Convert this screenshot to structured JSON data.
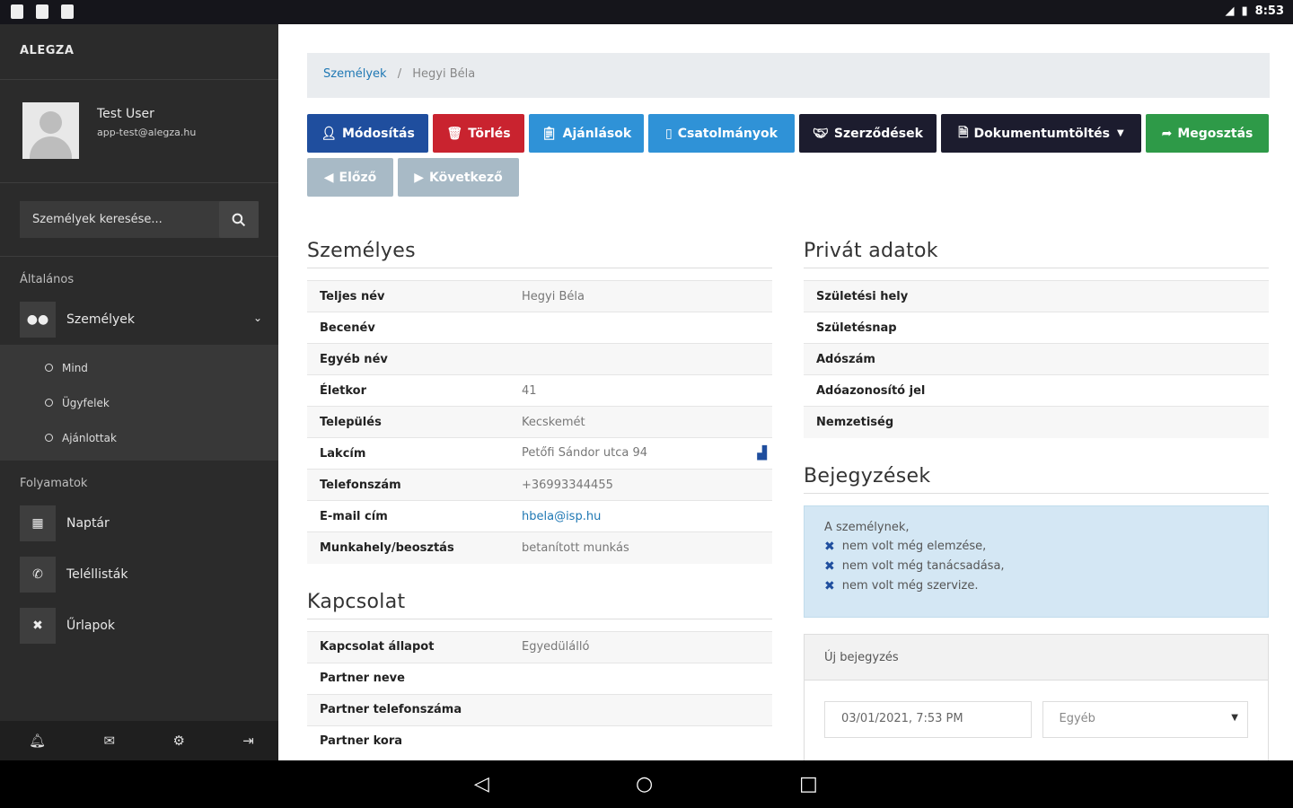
{
  "statusbar": {
    "time": "8:53"
  },
  "sidebar": {
    "brand": "ALEGZA",
    "user": {
      "name": "Test User",
      "email": "app-test@alegza.hu"
    },
    "search": {
      "placeholder": "Személyek keresése..."
    },
    "sections": [
      {
        "title": "Általános"
      },
      {
        "title": "Folyamatok"
      }
    ],
    "persons": {
      "label": "Személyek",
      "subitems": [
        "Mind",
        "Ügyfelek",
        "Ajánlottak"
      ]
    },
    "process_items": [
      "Naptár",
      "Teléllisták",
      "Űrlapok"
    ]
  },
  "breadcrumb": {
    "parent": "Személyek",
    "current": "Hegyi Béla"
  },
  "buttons": {
    "edit": "Módosítás",
    "delete": "Törlés",
    "offers": "Ajánlások",
    "attachments": "Csatolmányok",
    "contracts": "Szerződések",
    "download": "Dokumentumtöltés",
    "share": "Megosztás",
    "prev": "Előző",
    "next": "Következő"
  },
  "personal": {
    "title": "Személyes",
    "rows": [
      {
        "label": "Teljes név",
        "value": "Hegyi Béla"
      },
      {
        "label": "Becenév",
        "value": ""
      },
      {
        "label": "Egyéb név",
        "value": ""
      },
      {
        "label": "Életkor",
        "value": "41"
      },
      {
        "label": "Település",
        "value": "Kecskemét"
      },
      {
        "label": "Lakcím",
        "value": "Petőfi Sándor utca 94"
      },
      {
        "label": "Telefonszám",
        "value": "+36993344455"
      },
      {
        "label": "E-mail cím",
        "value": "hbela@isp.hu"
      },
      {
        "label": "Munkahely/beosztás",
        "value": "betanított munkás"
      }
    ]
  },
  "contact": {
    "title": "Kapcsolat",
    "rows": [
      {
        "label": "Kapcsolat állapot",
        "value": "Egyedülálló"
      },
      {
        "label": "Partner neve",
        "value": ""
      },
      {
        "label": "Partner telefonszáma",
        "value": ""
      },
      {
        "label": "Partner kora",
        "value": ""
      }
    ]
  },
  "private": {
    "title": "Privát adatok",
    "rows": [
      {
        "label": "Születési hely",
        "value": ""
      },
      {
        "label": "Születésnap",
        "value": ""
      },
      {
        "label": "Adószám",
        "value": ""
      },
      {
        "label": "Adóazonosító jel",
        "value": ""
      },
      {
        "label": "Nemzetiség",
        "value": ""
      }
    ]
  },
  "entries": {
    "title": "Bejegyzések",
    "info_intro": "A személynek,",
    "info_items": [
      "nem volt még elemzése,",
      "nem volt még tanácsadása,",
      "nem volt még szervize."
    ],
    "new_entry": "Új bejegyzés",
    "date_value": "03/01/2021, 7:53 PM",
    "type_value": "Egyéb"
  },
  "colors": {
    "sidebar": "#2b2b2b",
    "primary": "#1f4e9e",
    "danger": "#c9232f",
    "info": "#2f92d7",
    "dark": "#1c1c2e",
    "success": "#2e9a48",
    "muted": "#a8bac6"
  }
}
